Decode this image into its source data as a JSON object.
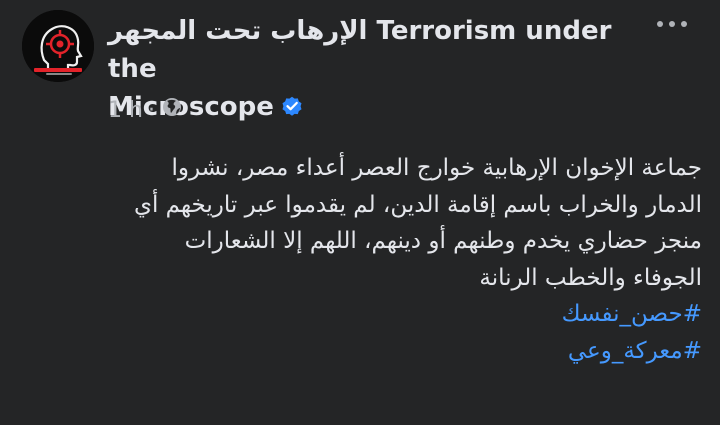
{
  "post": {
    "page_name_ar": "الإرهاب تحت المجهر",
    "page_name_en_1": "Terrorism under the",
    "page_name_en_2": "Microscope",
    "verified_icon": "verified-badge-icon",
    "time": "1 h",
    "separator": "·",
    "audience_icon": "globe-icon",
    "more_icon": "more-options-icon",
    "body_lines": [
      "جماعة الإخوان الإرهابية خوارج العصر أعداء مصر، نشروا",
      "الدمار والخراب باسم إقامة الدين، لم يقدموا عبر تاريخهم أي",
      "منجز حضاري يخدم وطنهم أو دينهم، اللهم إلا الشعارات",
      "الجوفاء والخطب الرنانة"
    ],
    "hashtags": [
      "#حصن_نفسك",
      "#معركة_وعي"
    ]
  },
  "colors": {
    "background": "#242526",
    "text_primary": "#e4e6eb",
    "text_secondary": "#b0b3b8",
    "link": "#4599ff",
    "verified": "#2d88ff"
  }
}
